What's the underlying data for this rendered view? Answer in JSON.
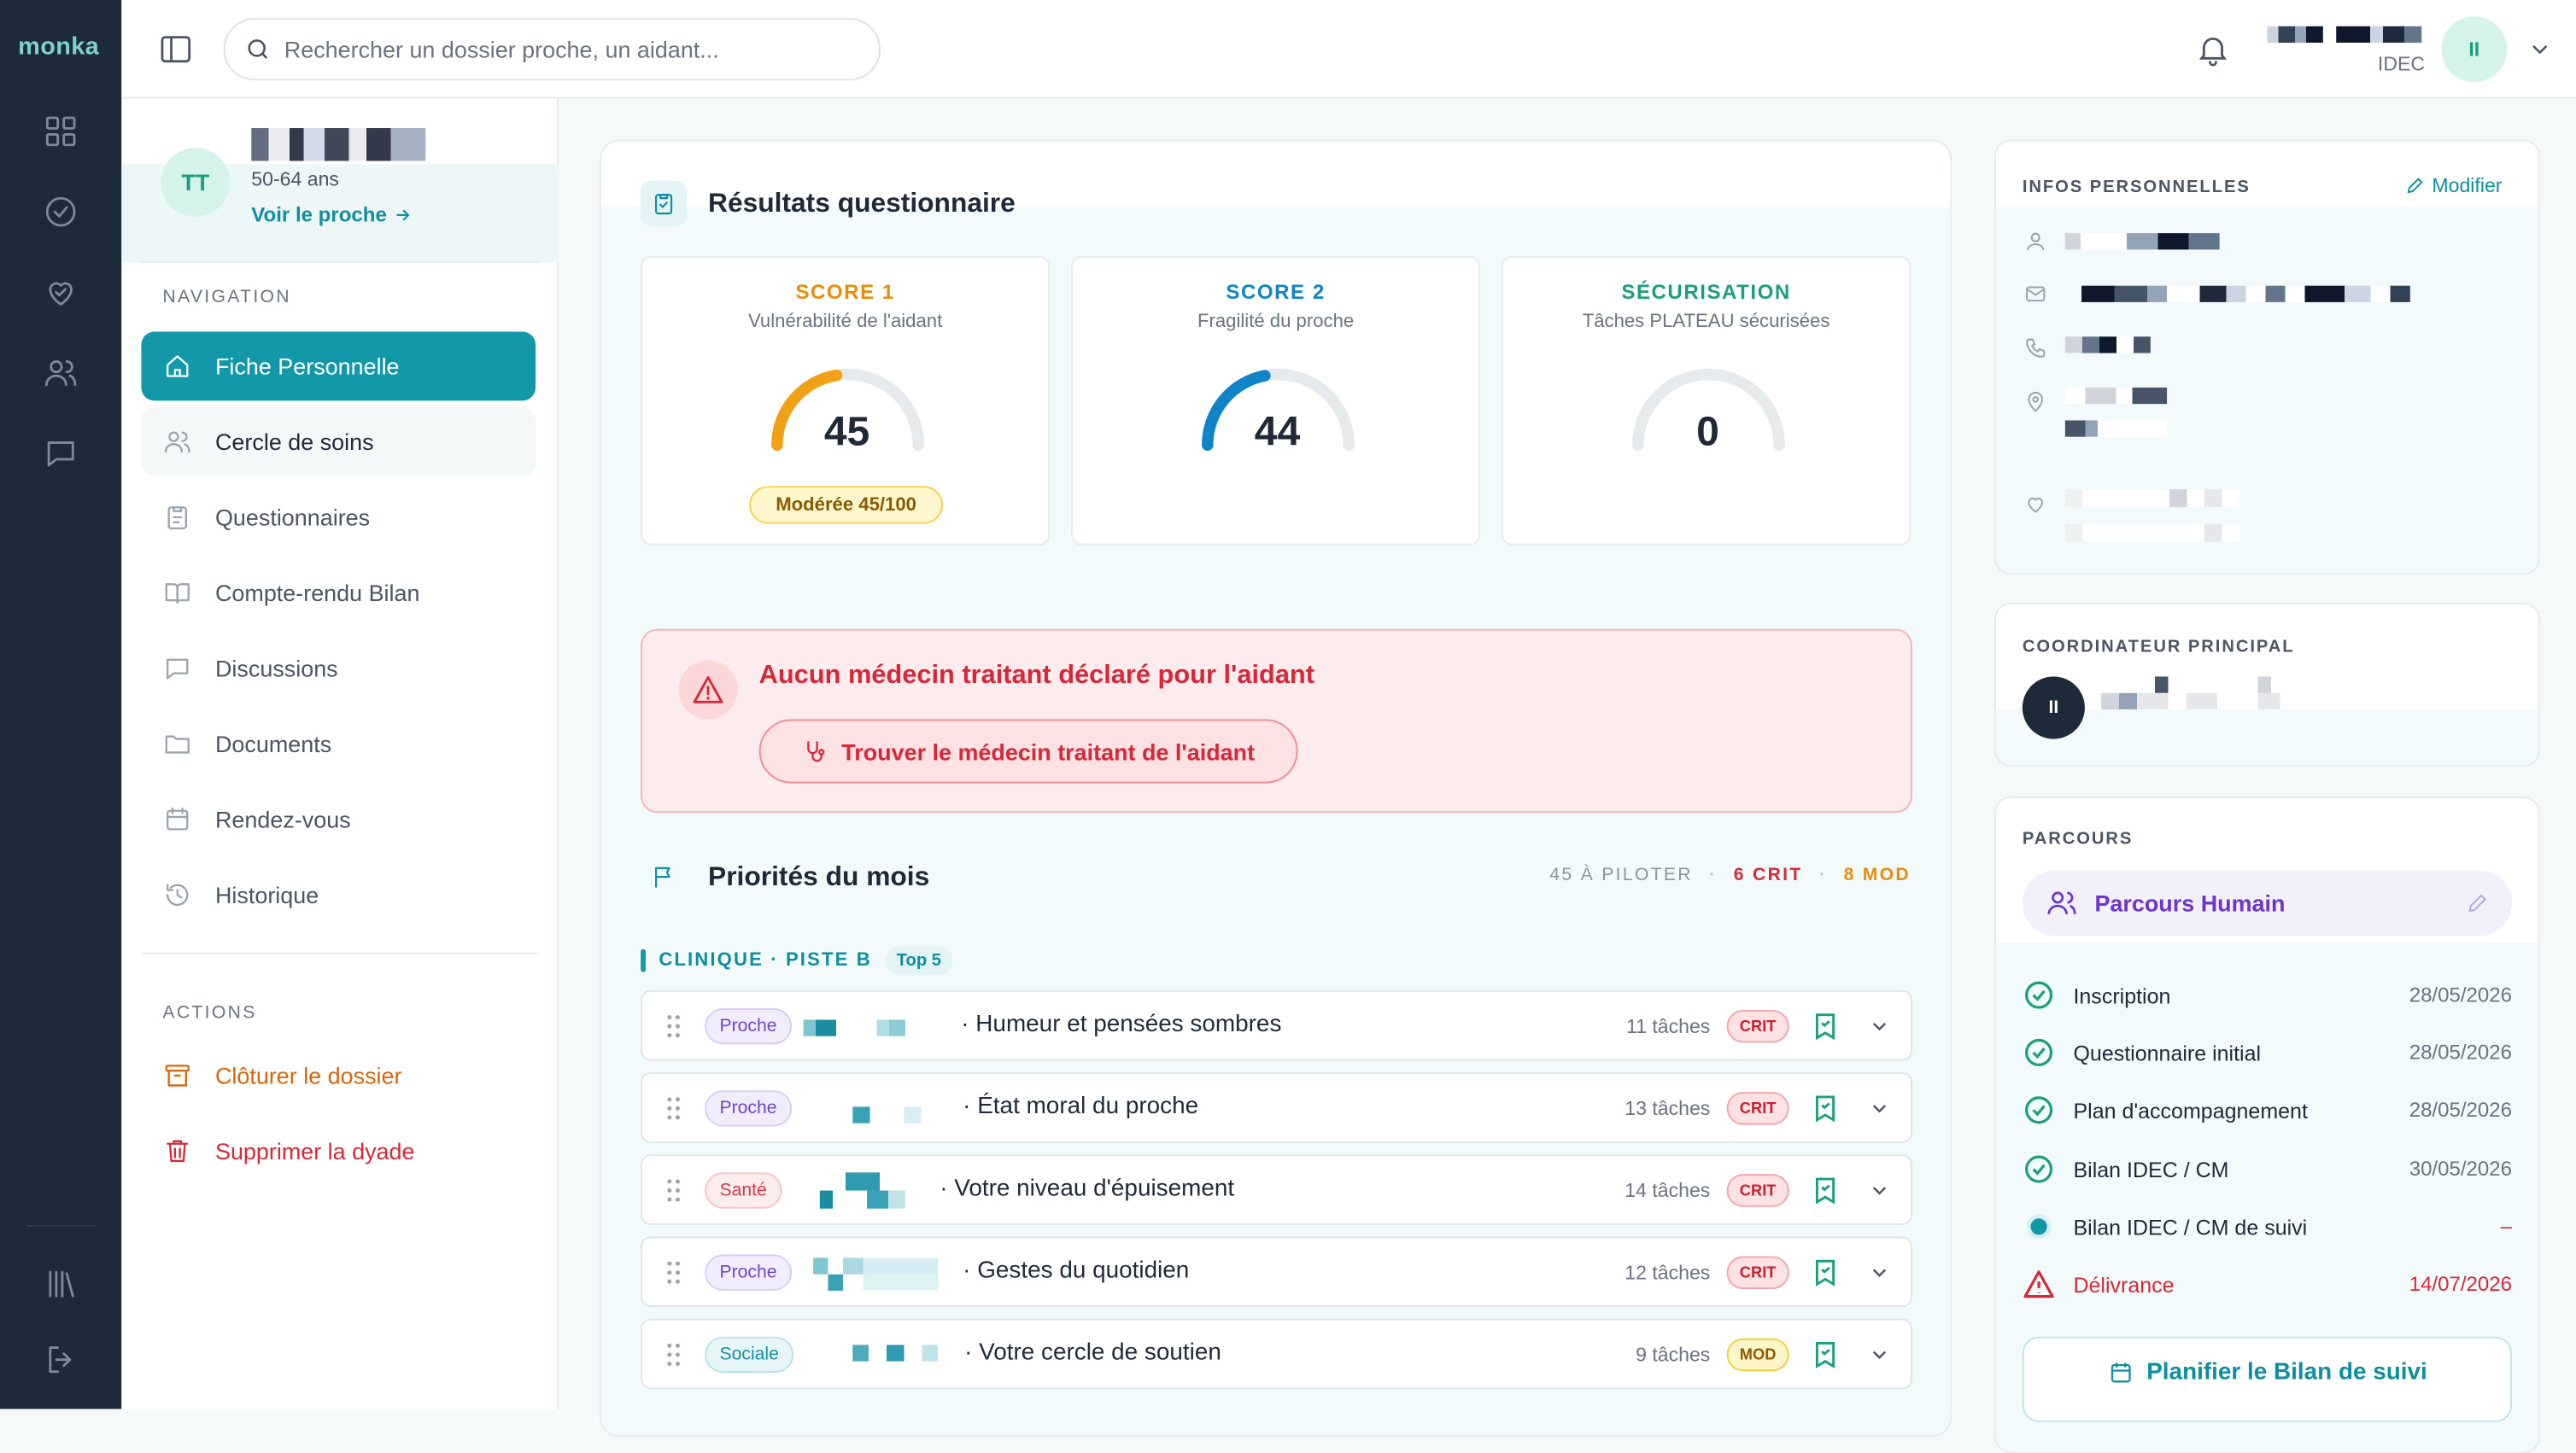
{
  "app": {
    "logo": "monka"
  },
  "topbar": {
    "search_placeholder": "Rechercher un dossier proche, un aidant...",
    "user_role": "IDEC",
    "user_initials": "II"
  },
  "patient": {
    "initials": "TT",
    "age": "50-64 ans",
    "see_link": "Voir le proche"
  },
  "navigation": {
    "label": "NAVIGATION",
    "items": [
      {
        "label": "Fiche Personnelle"
      },
      {
        "label": "Cercle de soins"
      },
      {
        "label": "Questionnaires"
      },
      {
        "label": "Compte-rendu Bilan"
      },
      {
        "label": "Discussions"
      },
      {
        "label": "Documents"
      },
      {
        "label": "Rendez-vous"
      },
      {
        "label": "Historique"
      }
    ]
  },
  "actions": {
    "label": "ACTIONS",
    "close": "Clôturer le dossier",
    "delete": "Supprimer la dyade"
  },
  "results": {
    "title": "Résultats questionnaire",
    "scores": [
      {
        "title": "SCORE 1",
        "subtitle": "Vulnérabilité de l'aidant",
        "value": "45",
        "level": 0.45,
        "badge": "Modérée 45/100",
        "color": "#f0a116"
      },
      {
        "title": "SCORE 2",
        "subtitle": "Fragilité du proche",
        "value": "44",
        "level": 0.44,
        "color": "#1184c9"
      },
      {
        "title": "SÉCURISATION",
        "subtitle": "Tâches PLATEAU sécurisées",
        "value": "0",
        "level": 0,
        "color": "#1a9e7d"
      }
    ]
  },
  "alert": {
    "text": "Aucun médecin traitant déclaré pour l'aidant",
    "button": "Trouver le médecin traitant de l'aidant"
  },
  "priorities": {
    "title": "Priorités du mois",
    "stat_total": "45 À PILOTER",
    "stat_crit": "6 CRIT",
    "stat_mod": "8 MOD",
    "category": "CLINIQUE · PISTE B",
    "top_badge": "Top 5",
    "rows": [
      {
        "tag": "Proche",
        "title": "· Humeur et pensées sombres",
        "tasks": "11 tâches",
        "level": "CRIT"
      },
      {
        "tag": "Proche",
        "title": "· État moral du proche",
        "tasks": "13 tâches",
        "level": "CRIT"
      },
      {
        "tag": "Santé",
        "title": "· Votre niveau d'épuisement",
        "tasks": "14 tâches",
        "level": "CRIT"
      },
      {
        "tag": "Proche",
        "title": "· Gestes du quotidien",
        "tasks": "12 tâches",
        "level": "CRIT"
      },
      {
        "tag": "Sociale",
        "title": "· Votre cercle de soutien",
        "tasks": "9 tâches",
        "level": "MOD"
      }
    ]
  },
  "infos": {
    "label": "INFOS PERSONNELLES",
    "modify": "Modifier"
  },
  "coordinator": {
    "label": "COORDINATEUR PRINCIPAL",
    "initials": "II"
  },
  "parcours": {
    "label": "PARCOURS",
    "name": "Parcours Humain",
    "steps": [
      {
        "label": "Inscription",
        "date": "28/05/2026",
        "status": "done"
      },
      {
        "label": "Questionnaire initial",
        "date": "28/05/2026",
        "status": "done"
      },
      {
        "label": "Plan d'accompagnement",
        "date": "28/05/2026",
        "status": "done"
      },
      {
        "label": "Bilan IDEC / CM",
        "date": "30/05/2026",
        "status": "done"
      },
      {
        "label": "Bilan IDEC / CM de suivi",
        "date": "–",
        "status": "current"
      },
      {
        "label": "Délivrance",
        "date": "14/07/2026",
        "status": "alert"
      }
    ],
    "plan_button": "Planifier le Bilan de suivi"
  },
  "colors": {
    "accent": "#1298a8",
    "danger": "#d62839",
    "warning": "#f0a116",
    "brand_dark": "#1d2a3a"
  }
}
